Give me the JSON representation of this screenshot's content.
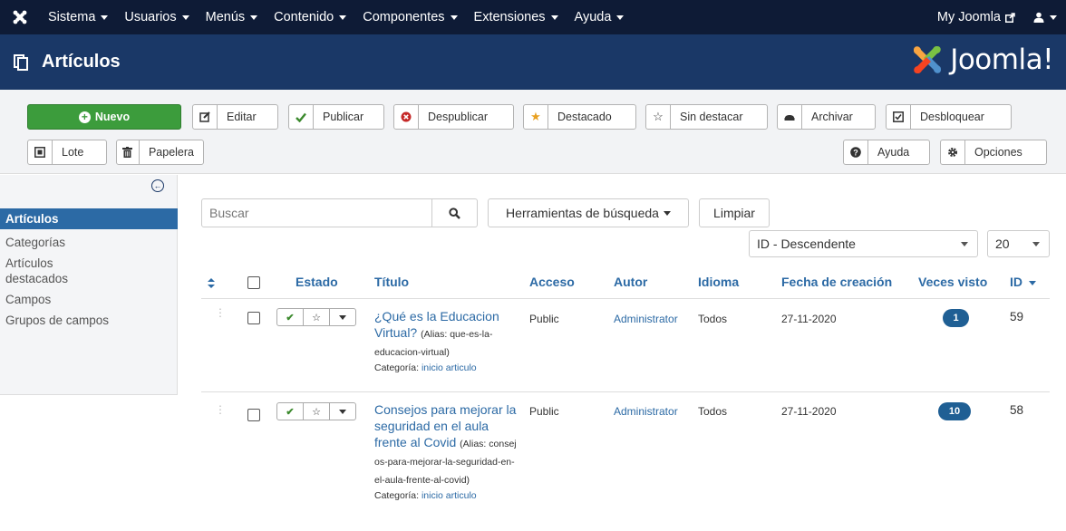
{
  "navbar": {
    "menu": [
      "Sistema",
      "Usuarios",
      "Menús",
      "Contenido",
      "Componentes",
      "Extensiones",
      "Ayuda"
    ],
    "my_joomla": "My Joomla",
    "icons": {
      "logo": "joomla-logo-icon",
      "external": "external-link-icon",
      "user": "user-icon"
    }
  },
  "header": {
    "title": "Artículos",
    "brand": "Joomla!"
  },
  "toolbar": {
    "new_label": "Nuevo",
    "buttons": [
      {
        "label": "Editar",
        "icon": "edit-icon"
      },
      {
        "label": "Publicar",
        "icon": "check-icon"
      },
      {
        "label": "Despublicar",
        "icon": "unpublish-icon"
      },
      {
        "label": "Destacado",
        "icon": "star-icon"
      },
      {
        "label": "Sin destacar",
        "icon": "star-empty-icon"
      },
      {
        "label": "Archivar",
        "icon": "archive-icon"
      },
      {
        "label": "Desbloquear",
        "icon": "checkin-icon"
      },
      {
        "label": "Lote",
        "icon": "batch-icon"
      },
      {
        "label": "Papelera",
        "icon": "trash-icon"
      },
      {
        "label": "Ayuda",
        "icon": "help-icon"
      },
      {
        "label": "Opciones",
        "icon": "options-icon"
      }
    ]
  },
  "sidebar": {
    "items": [
      {
        "label": "Artículos",
        "active": true
      },
      {
        "label": "Categorías",
        "active": false
      },
      {
        "label": "Artículos destacados",
        "active": false
      },
      {
        "label": "Campos",
        "active": false
      },
      {
        "label": "Grupos de campos",
        "active": false
      }
    ]
  },
  "filters": {
    "search_placeholder": "Buscar",
    "search_tools": "Herramientas de búsqueda",
    "clear": "Limpiar",
    "ordering": "ID - Descendente",
    "limit": "20"
  },
  "table": {
    "headers": {
      "status": "Estado",
      "title": "Título",
      "access": "Acceso",
      "author": "Autor",
      "language": "Idioma",
      "created": "Fecha de creación",
      "hits": "Veces visto",
      "id": "ID"
    },
    "rows": [
      {
        "title": "¿Qué es la Educacion Virtual?",
        "alias": "(Alias: que-es-la-educacion-virtual)",
        "category_label": "Categoría:",
        "category": "inicio articulo",
        "access": "Public",
        "author": "Administrator",
        "language": "Todos",
        "created": "27-11-2020",
        "hits": "1",
        "id": "59"
      },
      {
        "title": "Consejos para mejorar la seguridad en el aula frente al Covid",
        "alias": "(Alias: consejos-para-mejorar-la-seguridad-en-el-aula-frente-al-covid)",
        "category_label": "Categoría:",
        "category": "inicio articulo",
        "access": "Public",
        "author": "Administrator",
        "language": "Todos",
        "created": "27-11-2020",
        "hits": "10",
        "id": "58"
      }
    ]
  }
}
